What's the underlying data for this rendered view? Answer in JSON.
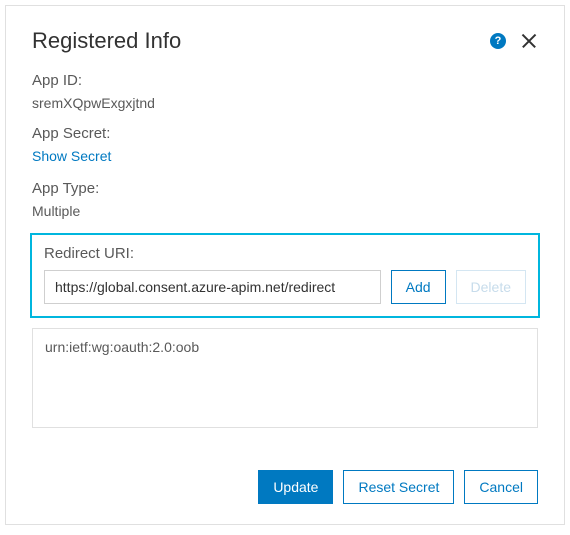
{
  "header": {
    "title": "Registered Info",
    "help_label": "?"
  },
  "appId": {
    "label": "App ID:",
    "value": "sremXQpwExgxjtnd"
  },
  "appSecret": {
    "label": "App Secret:",
    "show_link": "Show Secret"
  },
  "appType": {
    "label": "App Type:",
    "value": "Multiple"
  },
  "redirect": {
    "label": "Redirect URI:",
    "input_value": "https://global.consent.azure-apim.net/redirect",
    "add_label": "Add",
    "delete_label": "Delete",
    "items": [
      "urn:ietf:wg:oauth:2.0:oob"
    ]
  },
  "footer": {
    "update": "Update",
    "reset_secret": "Reset Secret",
    "cancel": "Cancel"
  }
}
